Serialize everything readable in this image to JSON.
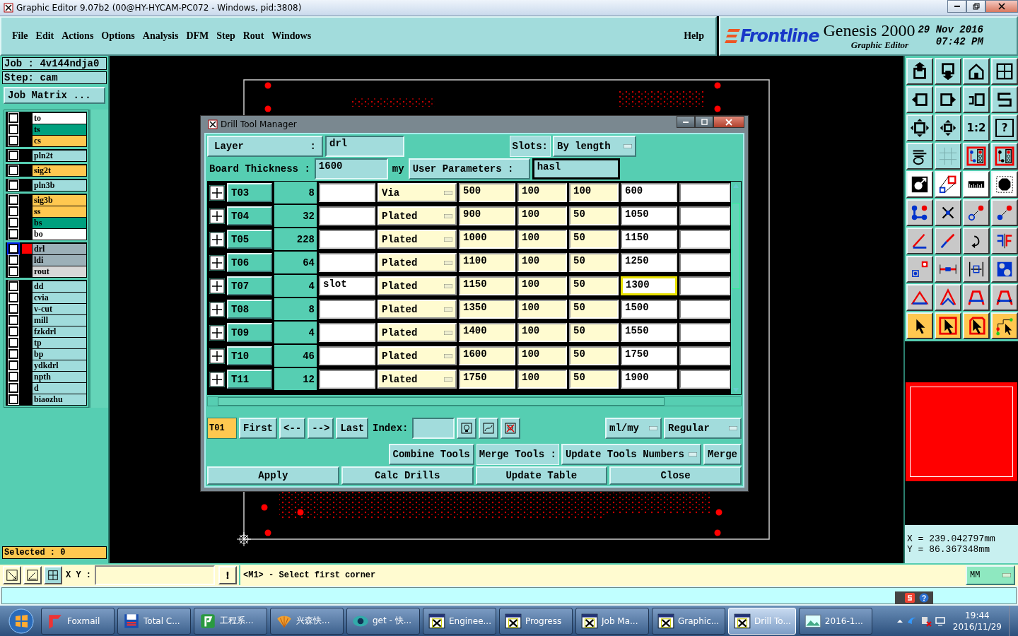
{
  "window": {
    "title": "Graphic Editor 9.07b2 (00@HY-HYCAM-PC072 - Windows, pid:3808)"
  },
  "menu": [
    "File",
    "Edit",
    "Actions",
    "Options",
    "Analysis",
    "DFM",
    "Step",
    "Rout",
    "Windows"
  ],
  "help_menu": "Help",
  "brand": {
    "logo": "Frontline",
    "product": "Genesis 2000",
    "subtitle": "Graphic Editor",
    "date": "29 Nov 2016",
    "time": "07:42 PM"
  },
  "job": {
    "job": "Job : 4v144ndja0",
    "step": "Step: cam",
    "matrix_button": "Job Matrix ..."
  },
  "layer_groups": [
    [
      {
        "name": "to",
        "color": "#ffffff",
        "checked": false,
        "selected": false
      },
      {
        "name": "ts",
        "color": "#00a07e",
        "checked": false,
        "selected": false
      },
      {
        "name": "cs",
        "color": "#ffc850",
        "checked": false,
        "selected": false
      }
    ],
    [
      {
        "name": "pln2t",
        "color": "#a0dcdc",
        "checked": false,
        "selected": false
      }
    ],
    [
      {
        "name": "sig2t",
        "color": "#ffc850",
        "checked": false,
        "selected": false
      }
    ],
    [
      {
        "name": "pln3b",
        "color": "#a0dcdc",
        "checked": false,
        "selected": false
      }
    ],
    [
      {
        "name": "sig3b",
        "color": "#ffc850",
        "checked": false,
        "selected": false
      },
      {
        "name": "ss",
        "color": "#ffc850",
        "checked": false,
        "selected": false
      },
      {
        "name": "bs",
        "color": "#00a07e",
        "checked": false,
        "selected": false
      },
      {
        "name": "bo",
        "color": "#ffffff",
        "checked": false,
        "selected": false
      }
    ],
    [
      {
        "name": "drl",
        "color": "#9cb0b8",
        "checked": false,
        "selected": true
      },
      {
        "name": "ldi",
        "color": "#9cb0b8",
        "checked": false,
        "selected": false
      },
      {
        "name": "rout",
        "color": "#d8d8d8",
        "checked": false,
        "selected": false
      }
    ],
    [
      {
        "name": "dd",
        "color": "#a0dcdc",
        "checked": false,
        "selected": false
      },
      {
        "name": "cvia",
        "color": "#a0dcdc",
        "checked": false,
        "selected": false
      },
      {
        "name": "v-cut",
        "color": "#a0dcdc",
        "checked": false,
        "selected": false
      },
      {
        "name": "mill",
        "color": "#a0dcdc",
        "checked": false,
        "selected": false
      },
      {
        "name": "fzkdrl",
        "color": "#a0dcdc",
        "checked": false,
        "selected": false
      },
      {
        "name": "tp",
        "color": "#a0dcdc",
        "checked": false,
        "selected": false
      },
      {
        "name": "bp",
        "color": "#a0dcdc",
        "checked": false,
        "selected": false
      },
      {
        "name": "ydkdrl",
        "color": "#a0dcdc",
        "checked": false,
        "selected": false
      },
      {
        "name": "npth",
        "color": "#a0dcdc",
        "checked": false,
        "selected": false
      },
      {
        "name": "d",
        "color": "#a0dcdc",
        "checked": false,
        "selected": false
      },
      {
        "name": "biaozhu",
        "color": "#a0dcdc",
        "checked": false,
        "selected": false
      }
    ]
  ],
  "selected_count": "Selected : 0",
  "dialog": {
    "title": "Drill Tool Manager",
    "layer_label": "Layer",
    "layer_colon": ":",
    "layer_value": "drl",
    "slots_label": "Slots:",
    "slots_value": "By length",
    "thickness_label": "Board Thickness :",
    "thickness_value": "1600",
    "thickness_unit": "my",
    "user_params_label": "User Parameters :",
    "user_params_value": "hasl",
    "rows": [
      {
        "tool": "T03",
        "count": "8",
        "type": "Via",
        "column_5": "500",
        "column_6": "100",
        "column_7": "100",
        "column_8": "600",
        "focused": false
      },
      {
        "tool": "T04",
        "count": "32",
        "type": "Plated",
        "column_5": "900",
        "column_6": "100",
        "column_7": "50",
        "column_8": "1050",
        "focused": false
      },
      {
        "tool": "T05",
        "count": "228",
        "type": "Plated",
        "column_5": "1000",
        "column_6": "100",
        "column_7": "50",
        "column_8": "1150",
        "focused": false
      },
      {
        "tool": "T06",
        "count": "64",
        "type": "Plated",
        "column_5": "1100",
        "column_6": "100",
        "column_7": "50",
        "column_8": "1250",
        "focused": false
      },
      {
        "tool": "T07",
        "count": "4",
        "column_3": "slot",
        "type": "Plated",
        "column_5": "1150",
        "column_6": "100",
        "column_7": "50",
        "column_8": "1300",
        "focused": true
      },
      {
        "tool": "T08",
        "count": "8",
        "type": "Plated",
        "column_5": "1350",
        "column_6": "100",
        "column_7": "50",
        "column_8": "1500",
        "focused": false
      },
      {
        "tool": "T09",
        "count": "4",
        "type": "Plated",
        "column_5": "1400",
        "column_6": "100",
        "column_7": "50",
        "column_8": "1550",
        "focused": false
      },
      {
        "tool": "T10",
        "count": "46",
        "type": "Plated",
        "column_5": "1600",
        "column_6": "100",
        "column_7": "50",
        "column_8": "1750",
        "focused": false
      },
      {
        "tool": "T11",
        "count": "12",
        "type": "Plated",
        "column_5": "1750",
        "column_6": "100",
        "column_7": "50",
        "column_8": "1900",
        "focused": false
      }
    ],
    "nav": {
      "current": "T01",
      "first": "First",
      "prev": "<--",
      "next": "-->",
      "last": "Last",
      "index_label": "Index:",
      "units": "ml/my",
      "mode": "Regular"
    },
    "merge": {
      "combine": "Combine Tools",
      "merge_label": "Merge Tools :",
      "merge_option": "Update Tools Numbers",
      "merge_button": "Merge"
    },
    "actions": [
      "Apply",
      "Calc Drills",
      "Update Table",
      "Close"
    ]
  },
  "right_toolbar": {
    "scale_label": "1:2",
    "help_label": "?"
  },
  "coordinates": {
    "x": "X = 239.042797mm",
    "y": "Y = 86.367348mm"
  },
  "command_bar": {
    "xy_label": "X Y :",
    "alert_button": "!",
    "prompt": "<M1> - Select first corner",
    "units": "MM"
  },
  "taskbar": {
    "items": [
      {
        "label": "Foxmail",
        "kind": "foxmail",
        "selected": false
      },
      {
        "label": "Total C...",
        "kind": "disk",
        "selected": false
      },
      {
        "label": "工程系...",
        "kind": "app",
        "selected": false
      },
      {
        "label": "兴森快...",
        "kind": "shell",
        "selected": false
      },
      {
        "label": "get - 快...",
        "kind": "eye",
        "selected": false
      },
      {
        "label": "Enginee...",
        "kind": "xwin",
        "selected": false
      },
      {
        "label": "Progress",
        "kind": "xwin",
        "selected": false
      },
      {
        "label": "Job Ma...",
        "kind": "xwin",
        "selected": false
      },
      {
        "label": "Graphic...",
        "kind": "xwin",
        "selected": false
      },
      {
        "label": "Drill To...",
        "kind": "xwin",
        "selected": true
      },
      {
        "label": "2016-1...",
        "kind": "photo",
        "selected": false
      }
    ],
    "time": "19:44",
    "date": "2016/11/29"
  }
}
